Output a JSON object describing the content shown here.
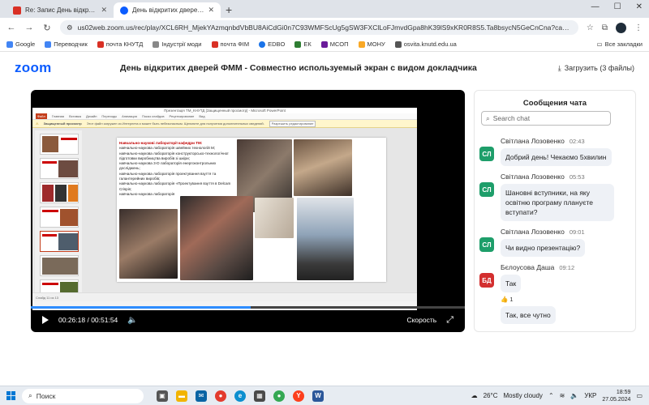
{
  "browser": {
    "tabs": [
      {
        "title": "Re: Запис День відкритих двер",
        "active": false,
        "favicon_color": "#d93025"
      },
      {
        "title": "День відкритих дверей ФММ",
        "active": true,
        "favicon_color": "#0b5cff"
      }
    ],
    "url": "us02web.zoom.us/rec/play/XCL6RH_MjekYAzmqnbdVbBU8AiCdGi0n7C93WMFScUg5gSW3FXClLoFJmvdGpa8hK39lS9xKR0R8S5.Ta8bsycN5GeCnCna?canPlayFromShare=true&from...",
    "bookmarks": [
      {
        "label": "Google",
        "color": "#4285f4"
      },
      {
        "label": "Переводчик",
        "color": "#4285f4"
      },
      {
        "label": "почта КНУТД",
        "color": "#d93025"
      },
      {
        "label": "Індустрії моди",
        "color": "#888888"
      },
      {
        "label": "почта ФІМ",
        "color": "#d93025"
      },
      {
        "label": "EDBO",
        "color": "#1a73e8"
      },
      {
        "label": "ЕК",
        "color": "#2e7d32"
      },
      {
        "label": "МСОП",
        "color": "#6a1b9a"
      },
      {
        "label": "МОНУ",
        "color": "#f9a825"
      },
      {
        "label": "osvita.knutd.edu.ua",
        "color": "#555555"
      }
    ],
    "all_bookmarks": "Все закладки"
  },
  "zoom": {
    "logo": "zoom",
    "title": "День відкритих дверей ФММ - Совместно используемый экран с видом докладчика",
    "download": "Загрузить (3 файлы)"
  },
  "player": {
    "current_time": "00:26:18",
    "total_time": "00:51:54",
    "speed_label": "Скорость",
    "progress": 0.507
  },
  "slide": {
    "window_title": "Презентація ТМ_КНУТД [Защищенный просмотр] - Microsoft PowerPoint",
    "ribbon": [
      "Файл",
      "Главная",
      "Вставка",
      "Дизайн",
      "Переходы",
      "Анимация",
      "Показ слайдов",
      "Рецензирование",
      "Вид"
    ],
    "warning": "Защищенный просмотр",
    "warning_text": "Этот файл загружен из Интернета и может быть небезопасным. Щелкните для получения дополнительных сведений.",
    "warning_button": "Разрешить редактирование",
    "heading": "Навчально-наукові лабораторії кафедри ТМ:",
    "items": [
      "навчально-наукова лабораторія швейних технологій М;",
      "навчально-наукова лабораторія конструкторсько-технологічної підготовки виробництва виробів зі шкіри;",
      "навчально-наукова 3-D лабораторія енергоконтрольних досліджень;",
      "навчально-наукова лабораторія проектування взуття та галантерейних виробів;",
      "навчально-наукова лабораторія «Проектування взуття в Delcam Crispin;",
      "навчально-наукова лабораторія"
    ],
    "status": "Слайд 11 из 13"
  },
  "chat": {
    "title": "Сообщения чата",
    "search_placeholder": "Search chat",
    "messages": [
      {
        "initials": "СЛ",
        "avatar_color": "#1e9e6a",
        "name": "Світлана Лозовенко",
        "time": "02:43",
        "text": "Добрий день! Чекаємо 5хвилин"
      },
      {
        "initials": "СЛ",
        "avatar_color": "#1e9e6a",
        "name": "Світлана Лозовенко",
        "time": "05:53",
        "text": "Шановні вступники, на яку освітню програму плануєте вступати?"
      },
      {
        "initials": "СЛ",
        "avatar_color": "#1e9e6a",
        "name": "Світлана Лозовенко",
        "time": "09:01",
        "text": "Чи видно презентацію?"
      },
      {
        "initials": "БД",
        "avatar_color": "#d32f2f",
        "name": "Бєлоусова Даша",
        "time": "09:12",
        "text": "Так"
      }
    ],
    "reaction_emoji": "👍",
    "reaction_count": "1",
    "followup": "Так, все чутно"
  },
  "taskbar": {
    "search": "Поиск",
    "weather_temp": "26°C",
    "weather_text": "Mostly cloudy",
    "lang": "УКР",
    "time": "18:59",
    "date": "27.05.2024"
  }
}
